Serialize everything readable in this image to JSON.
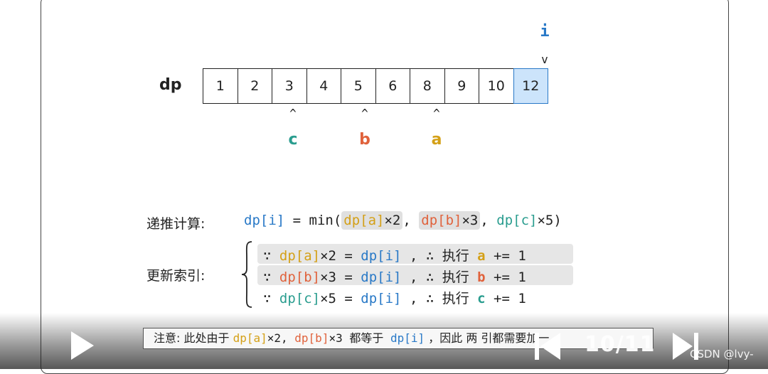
{
  "dp_label": "dp",
  "pointer_i": "i",
  "caret_down": "v",
  "caret_up": "^",
  "dp_values": [
    "1",
    "2",
    "3",
    "4",
    "5",
    "6",
    "8",
    "9",
    "10",
    "12"
  ],
  "pointers": {
    "c": "c",
    "b": "b",
    "a": "a"
  },
  "formula": {
    "label": "递推计算:",
    "lhs": "dp[i]",
    "eq": " = min(",
    "t1": "dp[a]",
    "t1m": "×2",
    "sep1": ", ",
    "t2": "dp[b]",
    "t2m": "×3",
    "sep2": ", ",
    "t3": "dp[c]",
    "t3m": "×5)"
  },
  "update": {
    "label": "更新索引:",
    "rows": [
      {
        "because": "∵ ",
        "term": "dp[a]",
        "mult": "×2 = ",
        "rhs": "dp[i]",
        "mid": " , ∴ 执行 ",
        "var": "a",
        "op": " += 1"
      },
      {
        "because": "∵ ",
        "term": "dp[b]",
        "mult": "×3 = ",
        "rhs": "dp[i]",
        "mid": " , ∴ 执行 ",
        "var": "b",
        "op": " += 1"
      },
      {
        "because": "∵ ",
        "term": "dp[c]",
        "mult": "×5 = ",
        "rhs": "dp[i]",
        "mid": " , ∴ 执行 ",
        "var": "c",
        "op": " += 1"
      }
    ]
  },
  "note": {
    "prefix": "注意: 此处由于 ",
    "t1": "dp[a]",
    "t1m": "×2, ",
    "t2": "dp[b]",
    "t2m": "×3 都等于 ",
    "t3": "dp[i]",
    "suffix": " ，因此 两 引都需要加一"
  },
  "player": {
    "page": "10/11",
    "watermark": "CSDN @lvy-"
  },
  "colors": {
    "blue": "#2979c7",
    "yellow": "#d4a017",
    "red": "#e0623c",
    "teal": "#2a9d8f"
  }
}
